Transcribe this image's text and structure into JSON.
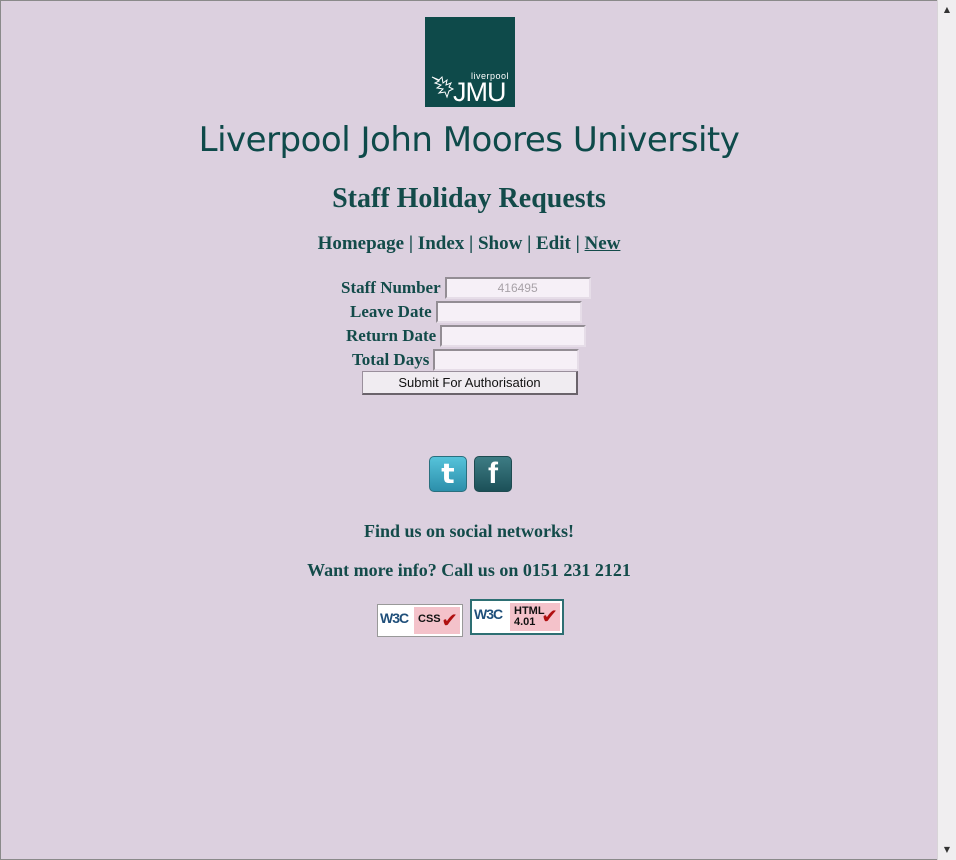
{
  "logo": {
    "small_text": "liverpool",
    "big_text": "JMU"
  },
  "university_name": "Liverpool John Moores University",
  "page_title": "Staff Holiday Requests",
  "nav": {
    "homepage": "Homepage",
    "index": "Index",
    "show": "Show",
    "edit": "Edit",
    "new": "New",
    "separator": "|"
  },
  "form": {
    "staff_number_label": "Staff Number",
    "staff_number_value": "416495",
    "leave_date_label": "Leave Date",
    "leave_date_value": "",
    "return_date_label": "Return Date",
    "return_date_value": "",
    "total_days_label": "Total Days",
    "total_days_value": "",
    "submit_label": "Submit For Authorisation"
  },
  "social": {
    "twitter_icon": "twitter-icon",
    "facebook_icon": "facebook-icon"
  },
  "footer": {
    "find_us": "Find us on social networks!",
    "call_us": "Want more info? Call us on 0151 231 2121"
  },
  "badges": {
    "css": {
      "w3c": "W3C",
      "label": "CSS"
    },
    "html": {
      "w3c": "W3C",
      "label_line1": "HTML",
      "label_line2": "4.01"
    }
  }
}
